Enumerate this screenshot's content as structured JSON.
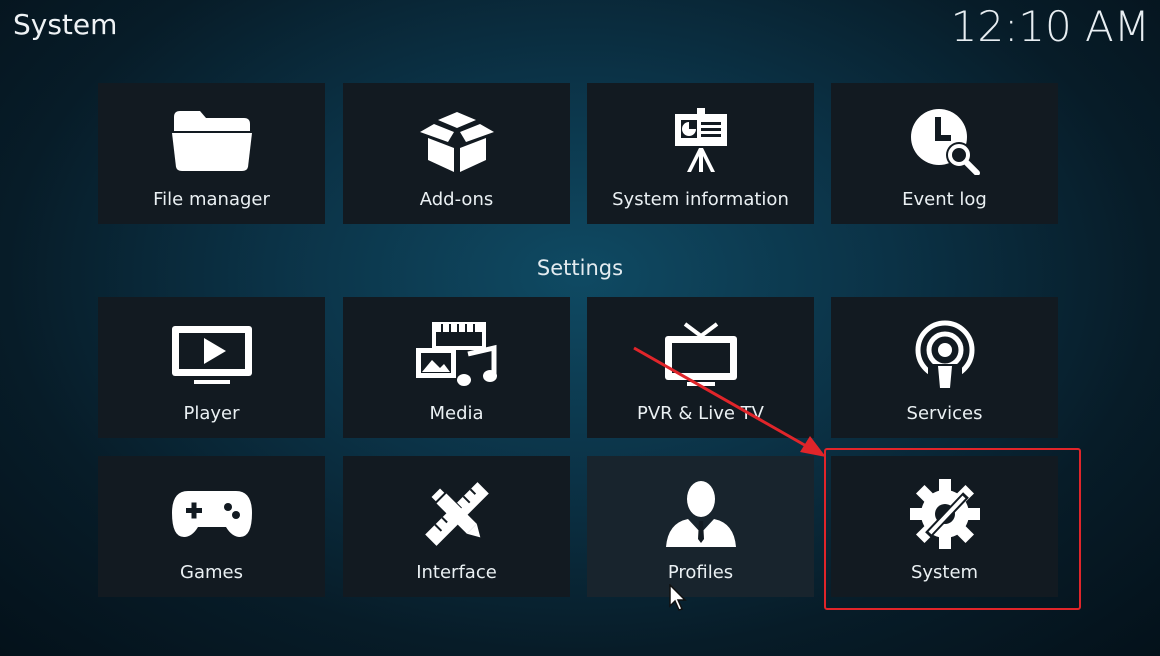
{
  "header": {
    "title": "System",
    "clock": "12:10 AM"
  },
  "section": {
    "settings_label": "Settings"
  },
  "top_tiles": [
    {
      "label": "File manager",
      "icon": "folder-icon"
    },
    {
      "label": "Add-ons",
      "icon": "box-icon"
    },
    {
      "label": "System information",
      "icon": "presentation-icon"
    },
    {
      "label": "Event log",
      "icon": "clock-search-icon"
    }
  ],
  "settings_tiles": [
    {
      "label": "Player",
      "icon": "tv-play-icon"
    },
    {
      "label": "Media",
      "icon": "media-icon"
    },
    {
      "label": "PVR & Live TV",
      "icon": "tv-antenna-icon"
    },
    {
      "label": "Services",
      "icon": "podcast-icon"
    },
    {
      "label": "Games",
      "icon": "gamepad-icon"
    },
    {
      "label": "Interface",
      "icon": "pencil-ruler-icon"
    },
    {
      "label": "Profiles",
      "icon": "person-icon"
    },
    {
      "label": "System",
      "icon": "gear-wrench-icon"
    }
  ],
  "colors": {
    "annotation": "#e0252a",
    "tile": "#121a21"
  }
}
